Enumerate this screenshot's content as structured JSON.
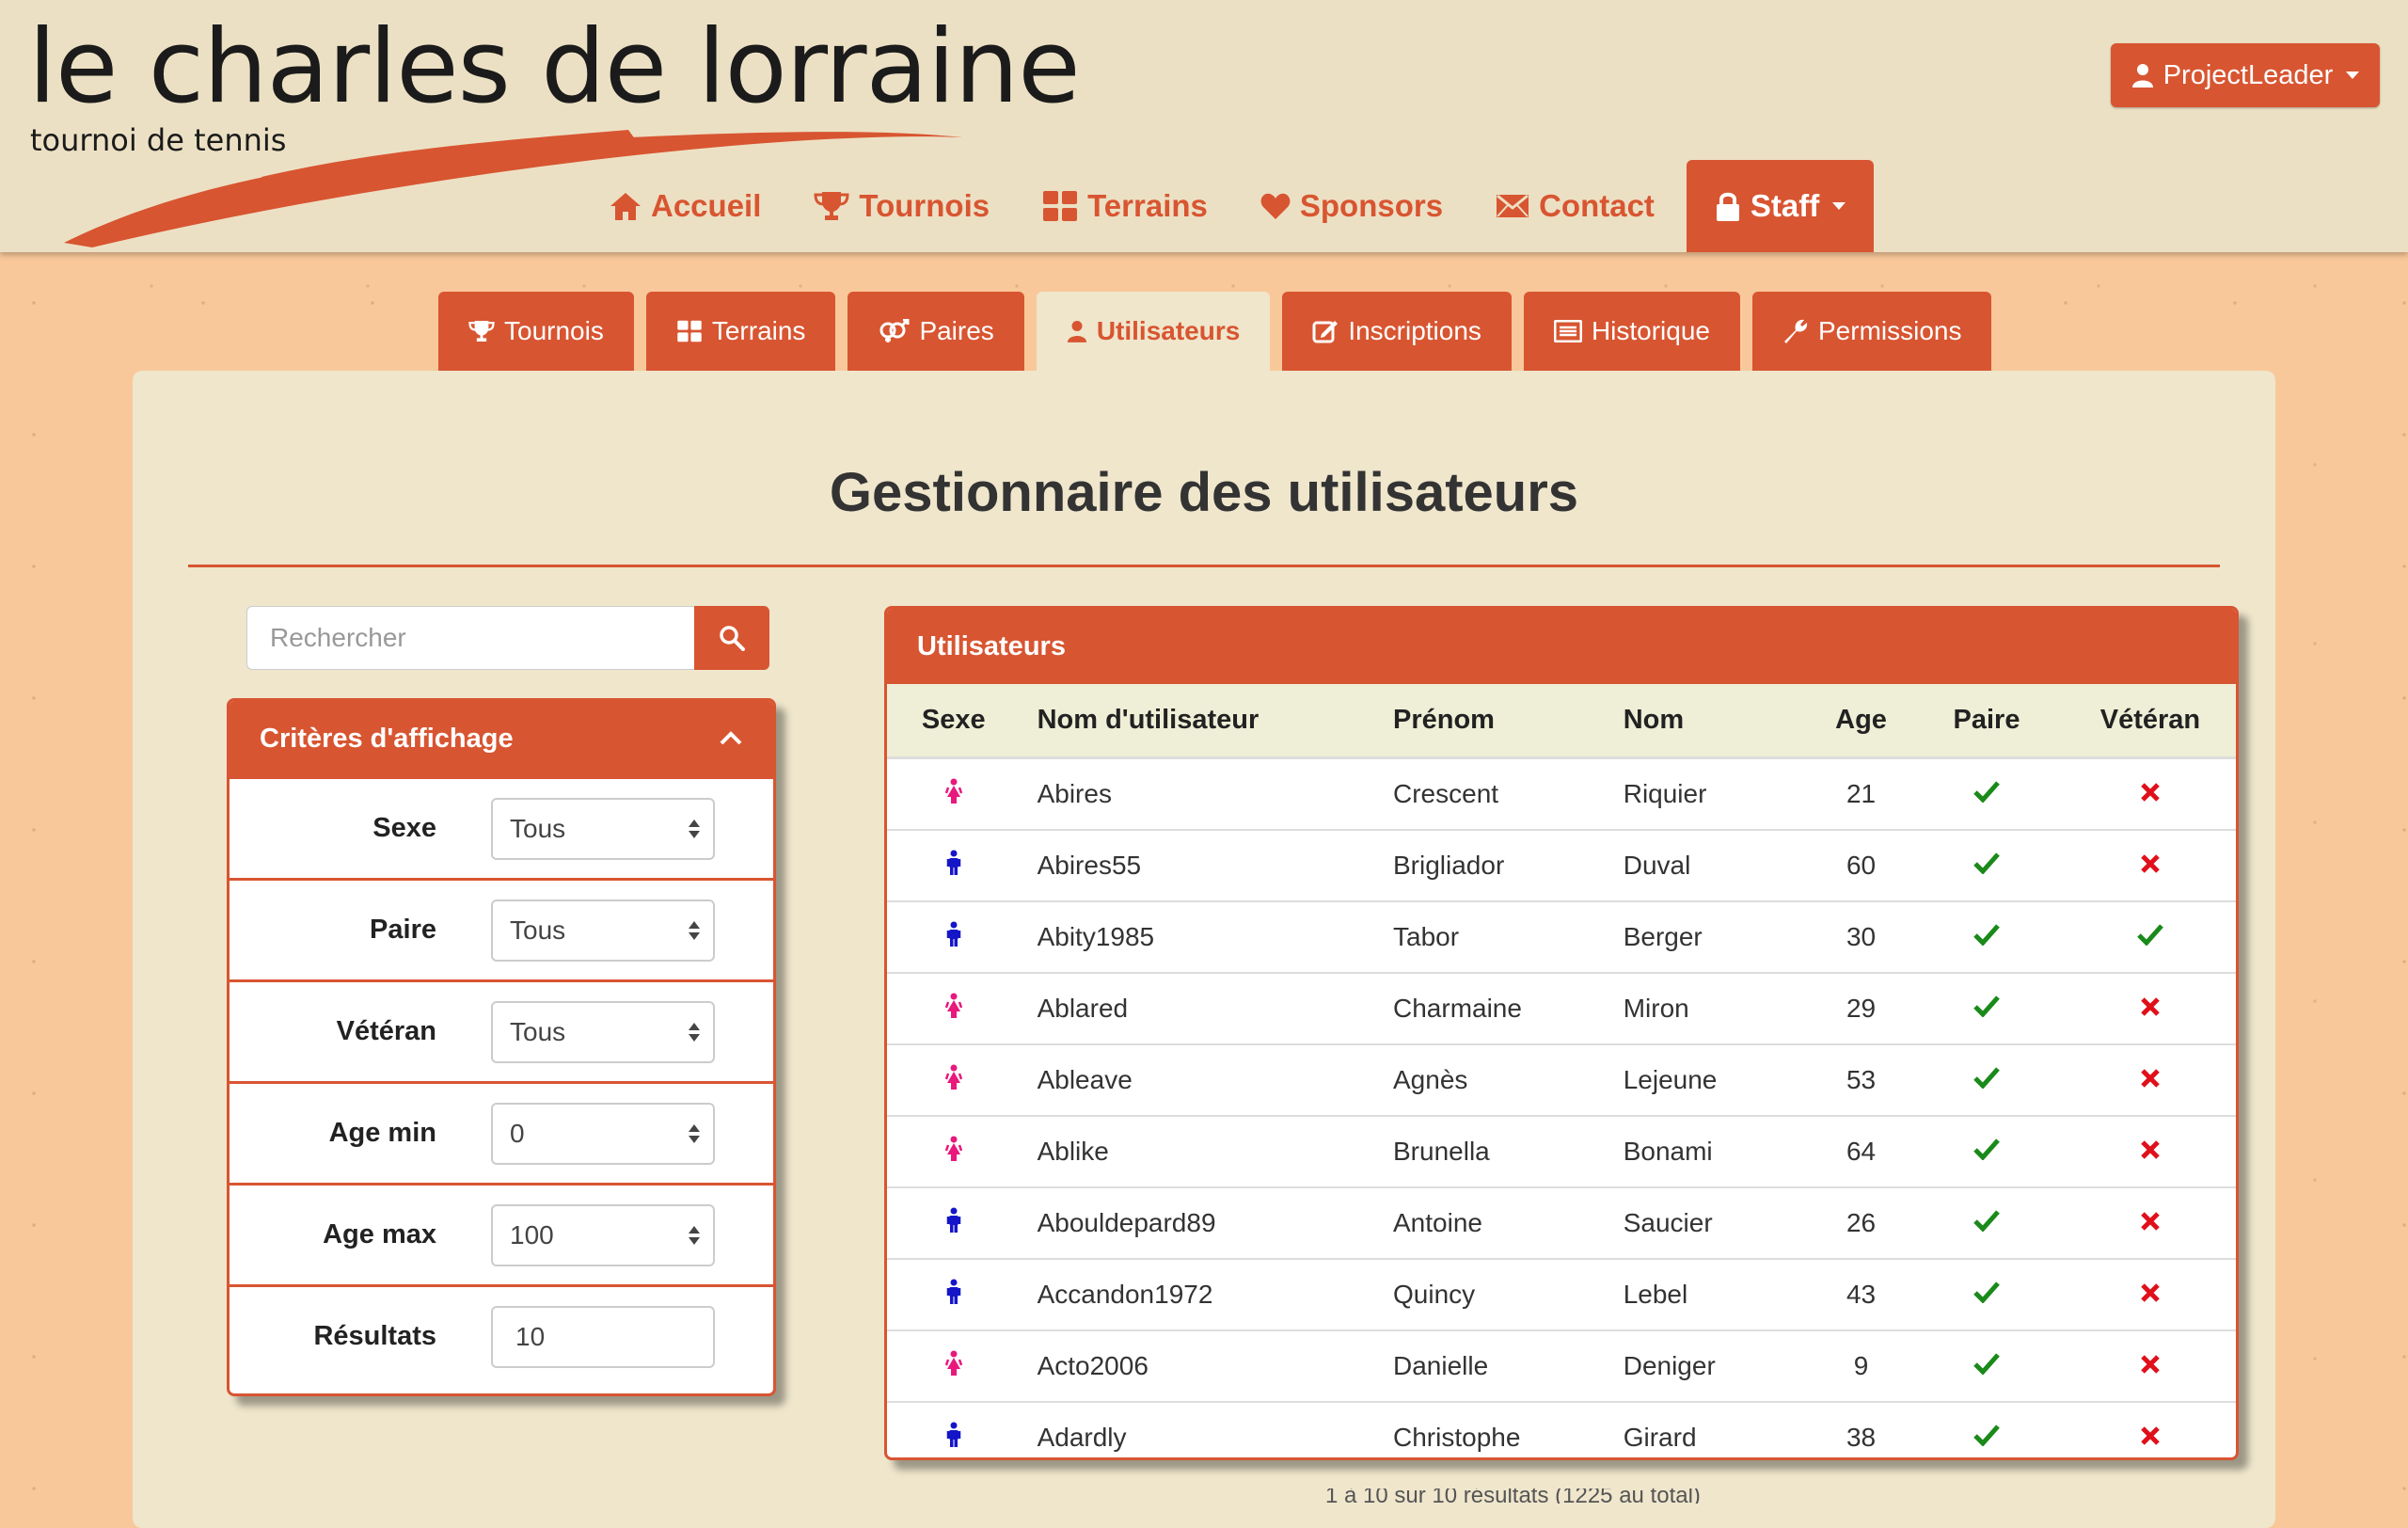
{
  "logo": {
    "title": "le charles de lorraine",
    "subtitle": "tournoi de tennis"
  },
  "user_menu": {
    "label": "ProjectLeader"
  },
  "nav": [
    {
      "label": "Accueil",
      "icon": "home-icon"
    },
    {
      "label": "Tournois",
      "icon": "trophy-icon"
    },
    {
      "label": "Terrains",
      "icon": "grid-icon"
    },
    {
      "label": "Sponsors",
      "icon": "heart-icon"
    },
    {
      "label": "Contact",
      "icon": "envelope-icon"
    },
    {
      "label": "Staff",
      "icon": "lock-icon"
    }
  ],
  "tabs": [
    {
      "label": "Tournois",
      "icon": "trophy-icon"
    },
    {
      "label": "Terrains",
      "icon": "grid-icon"
    },
    {
      "label": "Paires",
      "icon": "gender-pair-icon"
    },
    {
      "label": "Utilisateurs",
      "icon": "user-icon"
    },
    {
      "label": "Inscriptions",
      "icon": "edit-icon"
    },
    {
      "label": "Historique",
      "icon": "list-icon"
    },
    {
      "label": "Permissions",
      "icon": "wrench-icon"
    }
  ],
  "page_title": "Gestionnaire des utilisateurs",
  "search": {
    "placeholder": "Rechercher"
  },
  "filters": {
    "title": "Critères d'affichage",
    "rows": [
      {
        "label": "Sexe",
        "value": "Tous"
      },
      {
        "label": "Paire",
        "value": "Tous"
      },
      {
        "label": "Vétéran",
        "value": "Tous"
      },
      {
        "label": "Age min",
        "value": "0"
      },
      {
        "label": "Age max",
        "value": "100"
      },
      {
        "label": "Résultats",
        "value": "10"
      }
    ]
  },
  "users_table": {
    "title": "Utilisateurs",
    "columns": [
      "Sexe",
      "Nom d'utilisateur",
      "Prénom",
      "Nom",
      "Age",
      "Paire",
      "Vétéran"
    ],
    "rows": [
      {
        "sexe": "F",
        "username": "Abires",
        "prenom": "Crescent",
        "nom": "Riquier",
        "age": "21",
        "paire": true,
        "veteran": false
      },
      {
        "sexe": "M",
        "username": "Abires55",
        "prenom": "Brigliador",
        "nom": "Duval",
        "age": "60",
        "paire": true,
        "veteran": false
      },
      {
        "sexe": "M",
        "username": "Abity1985",
        "prenom": "Tabor",
        "nom": "Berger",
        "age": "30",
        "paire": true,
        "veteran": true
      },
      {
        "sexe": "F",
        "username": "Ablared",
        "prenom": "Charmaine",
        "nom": "Miron",
        "age": "29",
        "paire": true,
        "veteran": false
      },
      {
        "sexe": "F",
        "username": "Ableave",
        "prenom": "Agnès",
        "nom": "Lejeune",
        "age": "53",
        "paire": true,
        "veteran": false
      },
      {
        "sexe": "F",
        "username": "Ablike",
        "prenom": "Brunella",
        "nom": "Bonami",
        "age": "64",
        "paire": true,
        "veteran": false
      },
      {
        "sexe": "M",
        "username": "Abouldepard89",
        "prenom": "Antoine",
        "nom": "Saucier",
        "age": "26",
        "paire": true,
        "veteran": false
      },
      {
        "sexe": "M",
        "username": "Accandon1972",
        "prenom": "Quincy",
        "nom": "Lebel",
        "age": "43",
        "paire": true,
        "veteran": false
      },
      {
        "sexe": "F",
        "username": "Acto2006",
        "prenom": "Danielle",
        "nom": "Deniger",
        "age": "9",
        "paire": true,
        "veteran": false
      },
      {
        "sexe": "M",
        "username": "Adardly",
        "prenom": "Christophe",
        "nom": "Girard",
        "age": "38",
        "paire": true,
        "veteran": false
      }
    ]
  },
  "footer_text": "1 à 10 sur 10 résultats (1225 au total)",
  "colors": {
    "accent": "#d85531",
    "female": "#e8187c",
    "male": "#1515c8",
    "check": "#1a8a1a",
    "cross": "#e0101a"
  }
}
